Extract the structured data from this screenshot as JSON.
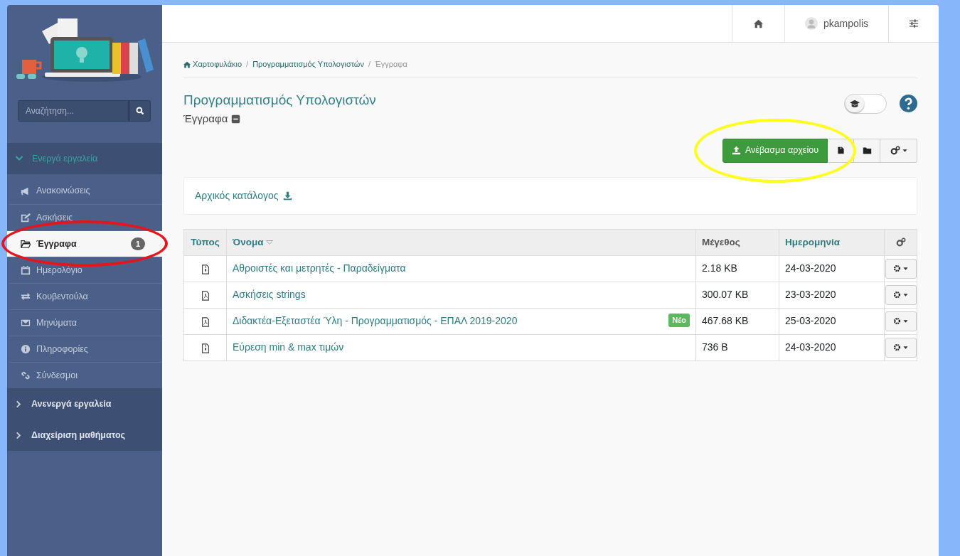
{
  "sidebar": {
    "search": {
      "placeholder": "Αναζήτηση..."
    },
    "sections": [
      {
        "label": "Ενεργά εργαλεία",
        "expanded": true,
        "items": [
          {
            "label": "Ανακοινώσεις",
            "selected": false
          },
          {
            "label": "Ασκήσεις",
            "selected": false
          },
          {
            "label": "Έγγραφα",
            "selected": true,
            "badge": "1"
          },
          {
            "label": "Ημερολόγιο",
            "selected": false
          },
          {
            "label": "Κουβεντούλα",
            "selected": false
          },
          {
            "label": "Μηνύματα",
            "selected": false
          },
          {
            "label": "Πληροφορίες",
            "selected": false
          },
          {
            "label": "Σύνδεσμοι",
            "selected": false
          }
        ]
      },
      {
        "label": "Ανενεργά εργαλεία",
        "expanded": false
      },
      {
        "label": "Διαχείριση μαθήματος",
        "expanded": false
      }
    ]
  },
  "header": {
    "username": "pkampolis"
  },
  "breadcrumb": [
    {
      "label": "Χαρτοφυλάκιο"
    },
    {
      "separator": "/",
      "label": "Προγραμματισμός Υπολογιστών"
    },
    {
      "separator": "/",
      "label": "Έγγραφα"
    }
  ],
  "view_toggle": {
    "on": false
  },
  "title": "Προγραμματισμός Υπολογιστών",
  "subtitle": "Έγγραφα",
  "upload_button": "Ανέβασμα αρχείου",
  "root_folder": "Αρχικός κατάλογος",
  "table": {
    "columns": [
      "Τύπος",
      "Όνομα",
      "Μέγεθος",
      "Ημερομηνία"
    ],
    "rows": [
      {
        "kind": "zip",
        "name": "Αθροιστές και μετρητές - Παραδείγματα",
        "size": "2.18 KB",
        "date": "24-03-2020"
      },
      {
        "kind": "pdf",
        "name": "Ασκήσεις strings",
        "size": "300.07 KB",
        "date": "23-03-2020"
      },
      {
        "kind": "pdf",
        "name": "Διδακτέα-Εξεταστέα Ύλη - Προγραμματισμός - ΕΠΑΛ 2019-2020",
        "badge": "Νέο",
        "size": "467.68 KB",
        "date": "25-03-2020"
      },
      {
        "kind": "zip",
        "name": "Εύρεση min & max τιμών",
        "size": "736 B",
        "date": "24-03-2020"
      }
    ]
  },
  "annotations": [
    {
      "color": "#e8141b"
    },
    {
      "color": "#ffff1a"
    }
  ]
}
